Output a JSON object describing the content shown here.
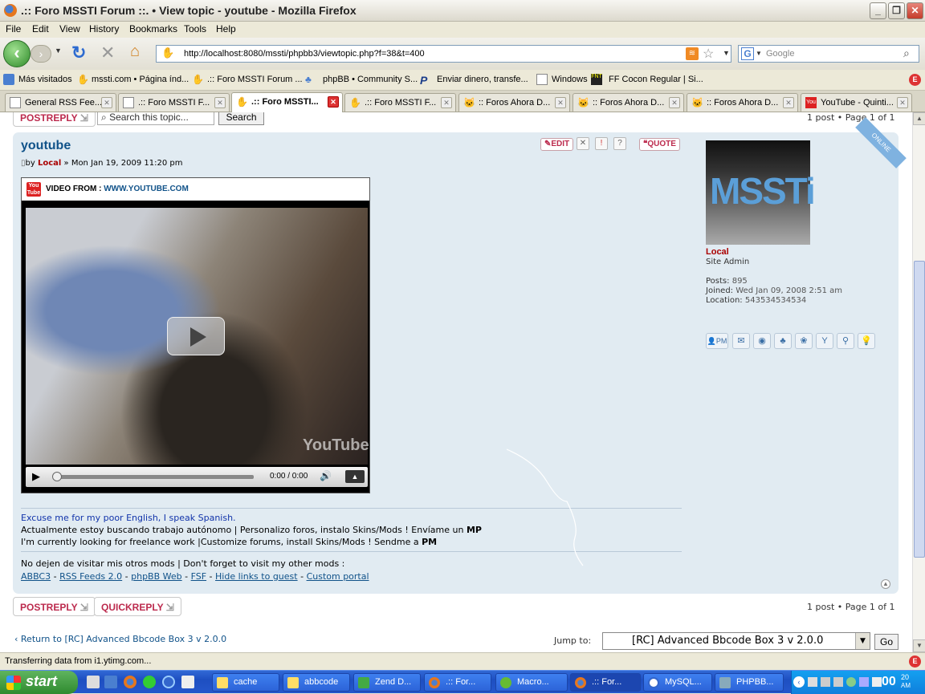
{
  "window": {
    "title": ".:: Foro MSSTI Forum ::. • View topic - youtube - Mozilla Firefox"
  },
  "menu": [
    "File",
    "Edit",
    "View",
    "History",
    "Bookmarks",
    "Tools",
    "Help"
  ],
  "nav": {
    "url": "http://localhost:8080/mssti/phpbb3/viewtopic.php?f=38&t=400",
    "search_placeholder": "Google"
  },
  "bookmarks": [
    "Más visitados",
    "mssti.com • Página índ...",
    ".:: Foro MSSTI Forum ...",
    "phpBB • Community S...",
    "Enviar dinero, transfe...",
    "Windows",
    "FF Cocon Regular | Si..."
  ],
  "tabs": [
    "General RSS Fee...",
    ".:: Foro MSSTI F...",
    ".:: Foro MSSTI...",
    ".:: Foro MSSTI F...",
    ":: Foros Ahora D...",
    ":: Foros Ahora D...",
    ":: Foros Ahora D...",
    "YouTube - Quinti..."
  ],
  "topbar": {
    "postreply": "POSTREPLY",
    "search_placeholder": "Search this topic...",
    "search_btn": "Search",
    "pagination": "1 post • Page 1 of 1"
  },
  "post": {
    "title": "youtube",
    "by": "by",
    "author": "Local",
    "date": "» Mon Jan 19, 2009 11:20 pm",
    "edit": "EDIT",
    "quote": "QUOTE",
    "video_from_label": "VIDEO FROM :",
    "video_from_site": "WWW.YOUTUBE.COM",
    "video_time": "0:00 / 0:00",
    "sig_line1": "Excuse me for my poor English, I speak Spanish.",
    "sig_line2a": "Actualmente estoy buscando trabajo autónomo | Personalizo foros, instalo Skins/Mods ! Envíame un ",
    "sig_line2b": "MP",
    "sig_line3a": "I'm currently looking for freelance work |Customize forums, install Skins/Mods ! Sendme a ",
    "sig_line3b": "PM",
    "sig_line4": "No dejen de visitar mis otros mods | Don't forget to visit my other mods :",
    "links": [
      "ABBC3",
      "RSS Feeds 2.0",
      "phpBB Web",
      "FSF",
      "Hide links to guest",
      "Custom portal"
    ],
    "link_sep": " - "
  },
  "profile": {
    "online": "ONLINE",
    "avatar_text": "MSSTi",
    "name": "Local",
    "rank": "Site Admin",
    "posts_label": "Posts:",
    "posts": "895",
    "joined_label": "Joined:",
    "joined": "Wed Jan 09, 2008 2:51 am",
    "location_label": "Location:",
    "location": "543534534534"
  },
  "bottombar": {
    "postreply": "POSTREPLY",
    "quickreply": "QUICKREPLY",
    "pagination": "1 post • Page 1 of 1",
    "return": "Return to [RC] Advanced Bbcode Box 3 v 2.0.0",
    "jump_label": "Jump to:",
    "jump_value": "[RC] Advanced Bbcode Box 3 v 2.0.0",
    "go": "Go"
  },
  "status": "Transferring data from i1.ytimg.com...",
  "taskbar": {
    "start": "start",
    "tasks": [
      "cache",
      "abbcode",
      "Zend D...",
      ".:: For...",
      "Macro...",
      ".:: For...",
      "MySQL...",
      "PHPBB..."
    ],
    "clock": "00",
    "clock2": "20",
    "ampm": "AM"
  },
  "colors": {
    "post_bg": "#e1ebf2",
    "accent": "#bc2a4d",
    "link": "#105289",
    "author": "#aa0000"
  }
}
